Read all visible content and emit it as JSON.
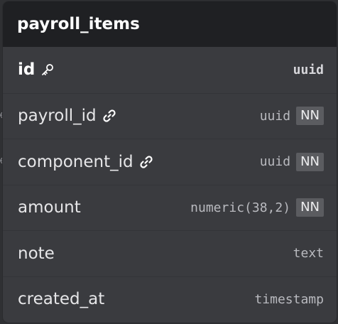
{
  "table": {
    "name": "payroll_items",
    "columns": [
      {
        "name": "id",
        "type": "uuid",
        "pk": true,
        "fk": false,
        "nn": false,
        "icon": "key-icon"
      },
      {
        "name": "payroll_id",
        "type": "uuid",
        "pk": false,
        "fk": true,
        "nn": true,
        "nn_label": "NN",
        "icon": "link-icon"
      },
      {
        "name": "component_id",
        "type": "uuid",
        "pk": false,
        "fk": true,
        "nn": true,
        "nn_label": "NN",
        "icon": "link-icon"
      },
      {
        "name": "amount",
        "type": "numeric(38,2)",
        "pk": false,
        "fk": false,
        "nn": true,
        "nn_label": "NN"
      },
      {
        "name": "note",
        "type": "text",
        "pk": false,
        "fk": false,
        "nn": false
      },
      {
        "name": "created_at",
        "type": "timestamp",
        "pk": false,
        "fk": false,
        "nn": false
      }
    ]
  },
  "colors": {
    "header_bg": "#1f2023",
    "body_bg": "#3a3b3f",
    "badge_bg": "#5b5c60"
  }
}
